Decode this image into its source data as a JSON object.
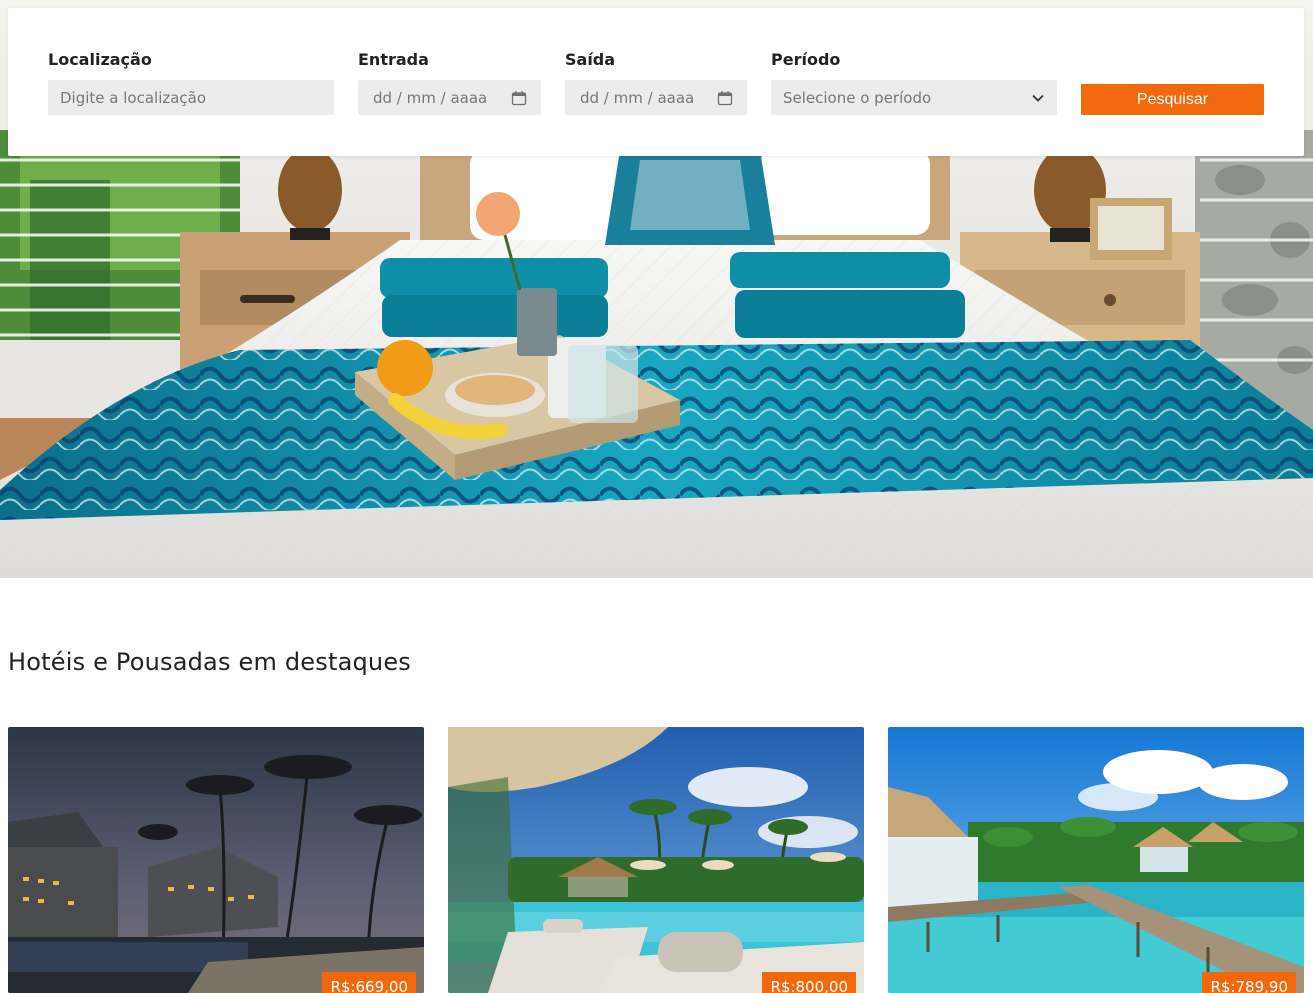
{
  "search": {
    "location": {
      "label": "Localização",
      "placeholder": "Digite a localização"
    },
    "checkin": {
      "label": "Entrada",
      "placeholder": "dd / mm / aaaa"
    },
    "checkout": {
      "label": "Saída",
      "placeholder": "dd / mm / aaaa"
    },
    "period": {
      "label": "Período",
      "selected": "Selecione o período"
    },
    "button_label": "Pesquisar"
  },
  "featured": {
    "title": "Hotéis e Pousadas em destaques",
    "cards": [
      {
        "price": "R$:669,00"
      },
      {
        "price": "R$:800,00"
      },
      {
        "price": "R$:789,90"
      }
    ]
  },
  "colors": {
    "accent": "#f2690d",
    "input_bg": "#ececec",
    "turquoise": "#0f8fa6"
  }
}
